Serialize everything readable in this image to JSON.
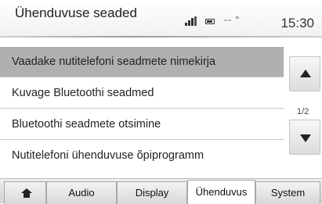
{
  "header": {
    "title": "Ühenduvuse seaded",
    "temperature": "-- °",
    "time": "15:30"
  },
  "menu": {
    "items": [
      {
        "label": "Vaadake nutitelefoni seadmete nimekirja",
        "selected": true
      },
      {
        "label": "Kuvage Bluetoothi seadmed",
        "selected": false
      },
      {
        "label": "Bluetoothi seadmete otsimine",
        "selected": false
      },
      {
        "label": "Nutitelefoni ühenduvuse õpiprogramm",
        "selected": false
      }
    ],
    "page_indicator": "1/2"
  },
  "tabs": {
    "home_icon": "home-icon",
    "items": [
      {
        "label": "Audio",
        "active": false
      },
      {
        "label": "Display",
        "active": false
      },
      {
        "label": "Ühenduvus",
        "active": true
      },
      {
        "label": "System",
        "active": false
      }
    ]
  }
}
